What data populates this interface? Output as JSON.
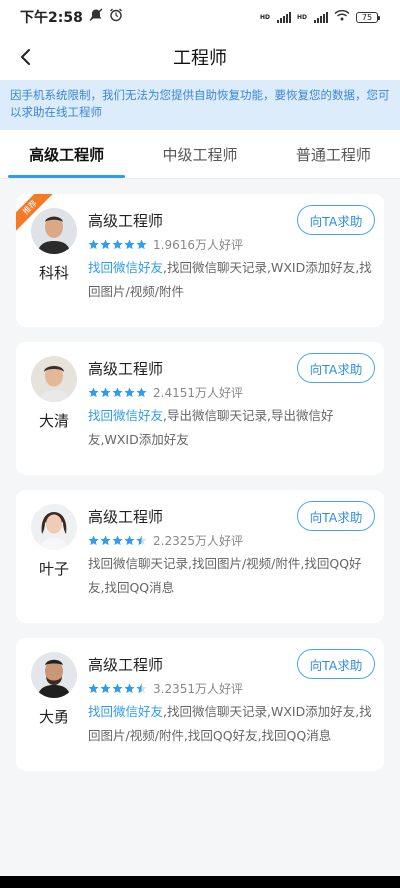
{
  "status_bar": {
    "time": "下午2:58",
    "battery": "75",
    "net_label": "HD"
  },
  "nav": {
    "title": "工程师"
  },
  "notice": {
    "text": "因手机系统限制，我们无法为您提供自助恢复功能，要恢复您的数据，您可以求助在线工程师"
  },
  "tabs": [
    {
      "label": "高级工程师",
      "active": true
    },
    {
      "label": "中级工程师",
      "active": false
    },
    {
      "label": "普通工程师",
      "active": false
    }
  ],
  "engineers": [
    {
      "name": "科科",
      "level": "高级工程师",
      "badge": "推荐",
      "rating_text": "1.9616万人好评",
      "stars": 5,
      "highlight": "找回微信好友",
      "desc_rest": ",找回微信聊天记录,WXID添加好友,找回图片/视频/附件",
      "button": "向TA求助"
    },
    {
      "name": "大清",
      "level": "高级工程师",
      "rating_text": "2.4151万人好评",
      "stars": 5,
      "highlight": "找回微信好友",
      "desc_rest": ",导出微信聊天记录,导出微信好友,WXID添加好友",
      "button": "向TA求助"
    },
    {
      "name": "叶子",
      "level": "高级工程师",
      "rating_text": "2.2325万人好评",
      "stars": 4.5,
      "highlight": "",
      "desc_rest": "找回微信聊天记录,找回图片/视频/附件,找回QQ好友,找回QQ消息",
      "button": "向TA求助"
    },
    {
      "name": "大勇",
      "level": "高级工程师",
      "rating_text": "3.2351万人好评",
      "stars": 4.5,
      "highlight": "找回微信好友",
      "desc_rest": ",找回微信聊天记录,WXID添加好友,找回图片/视频/附件,找回QQ好友,找回QQ消息",
      "button": "向TA求助"
    }
  ],
  "colors": {
    "accent": "#2e9cf0",
    "notice_bg": "#dcecfb",
    "badge": "#f47a26"
  },
  "icons": {
    "back": "chevron-left-icon",
    "star": "star-icon",
    "alarm": "alarm-icon",
    "wifi": "wifi-icon"
  }
}
